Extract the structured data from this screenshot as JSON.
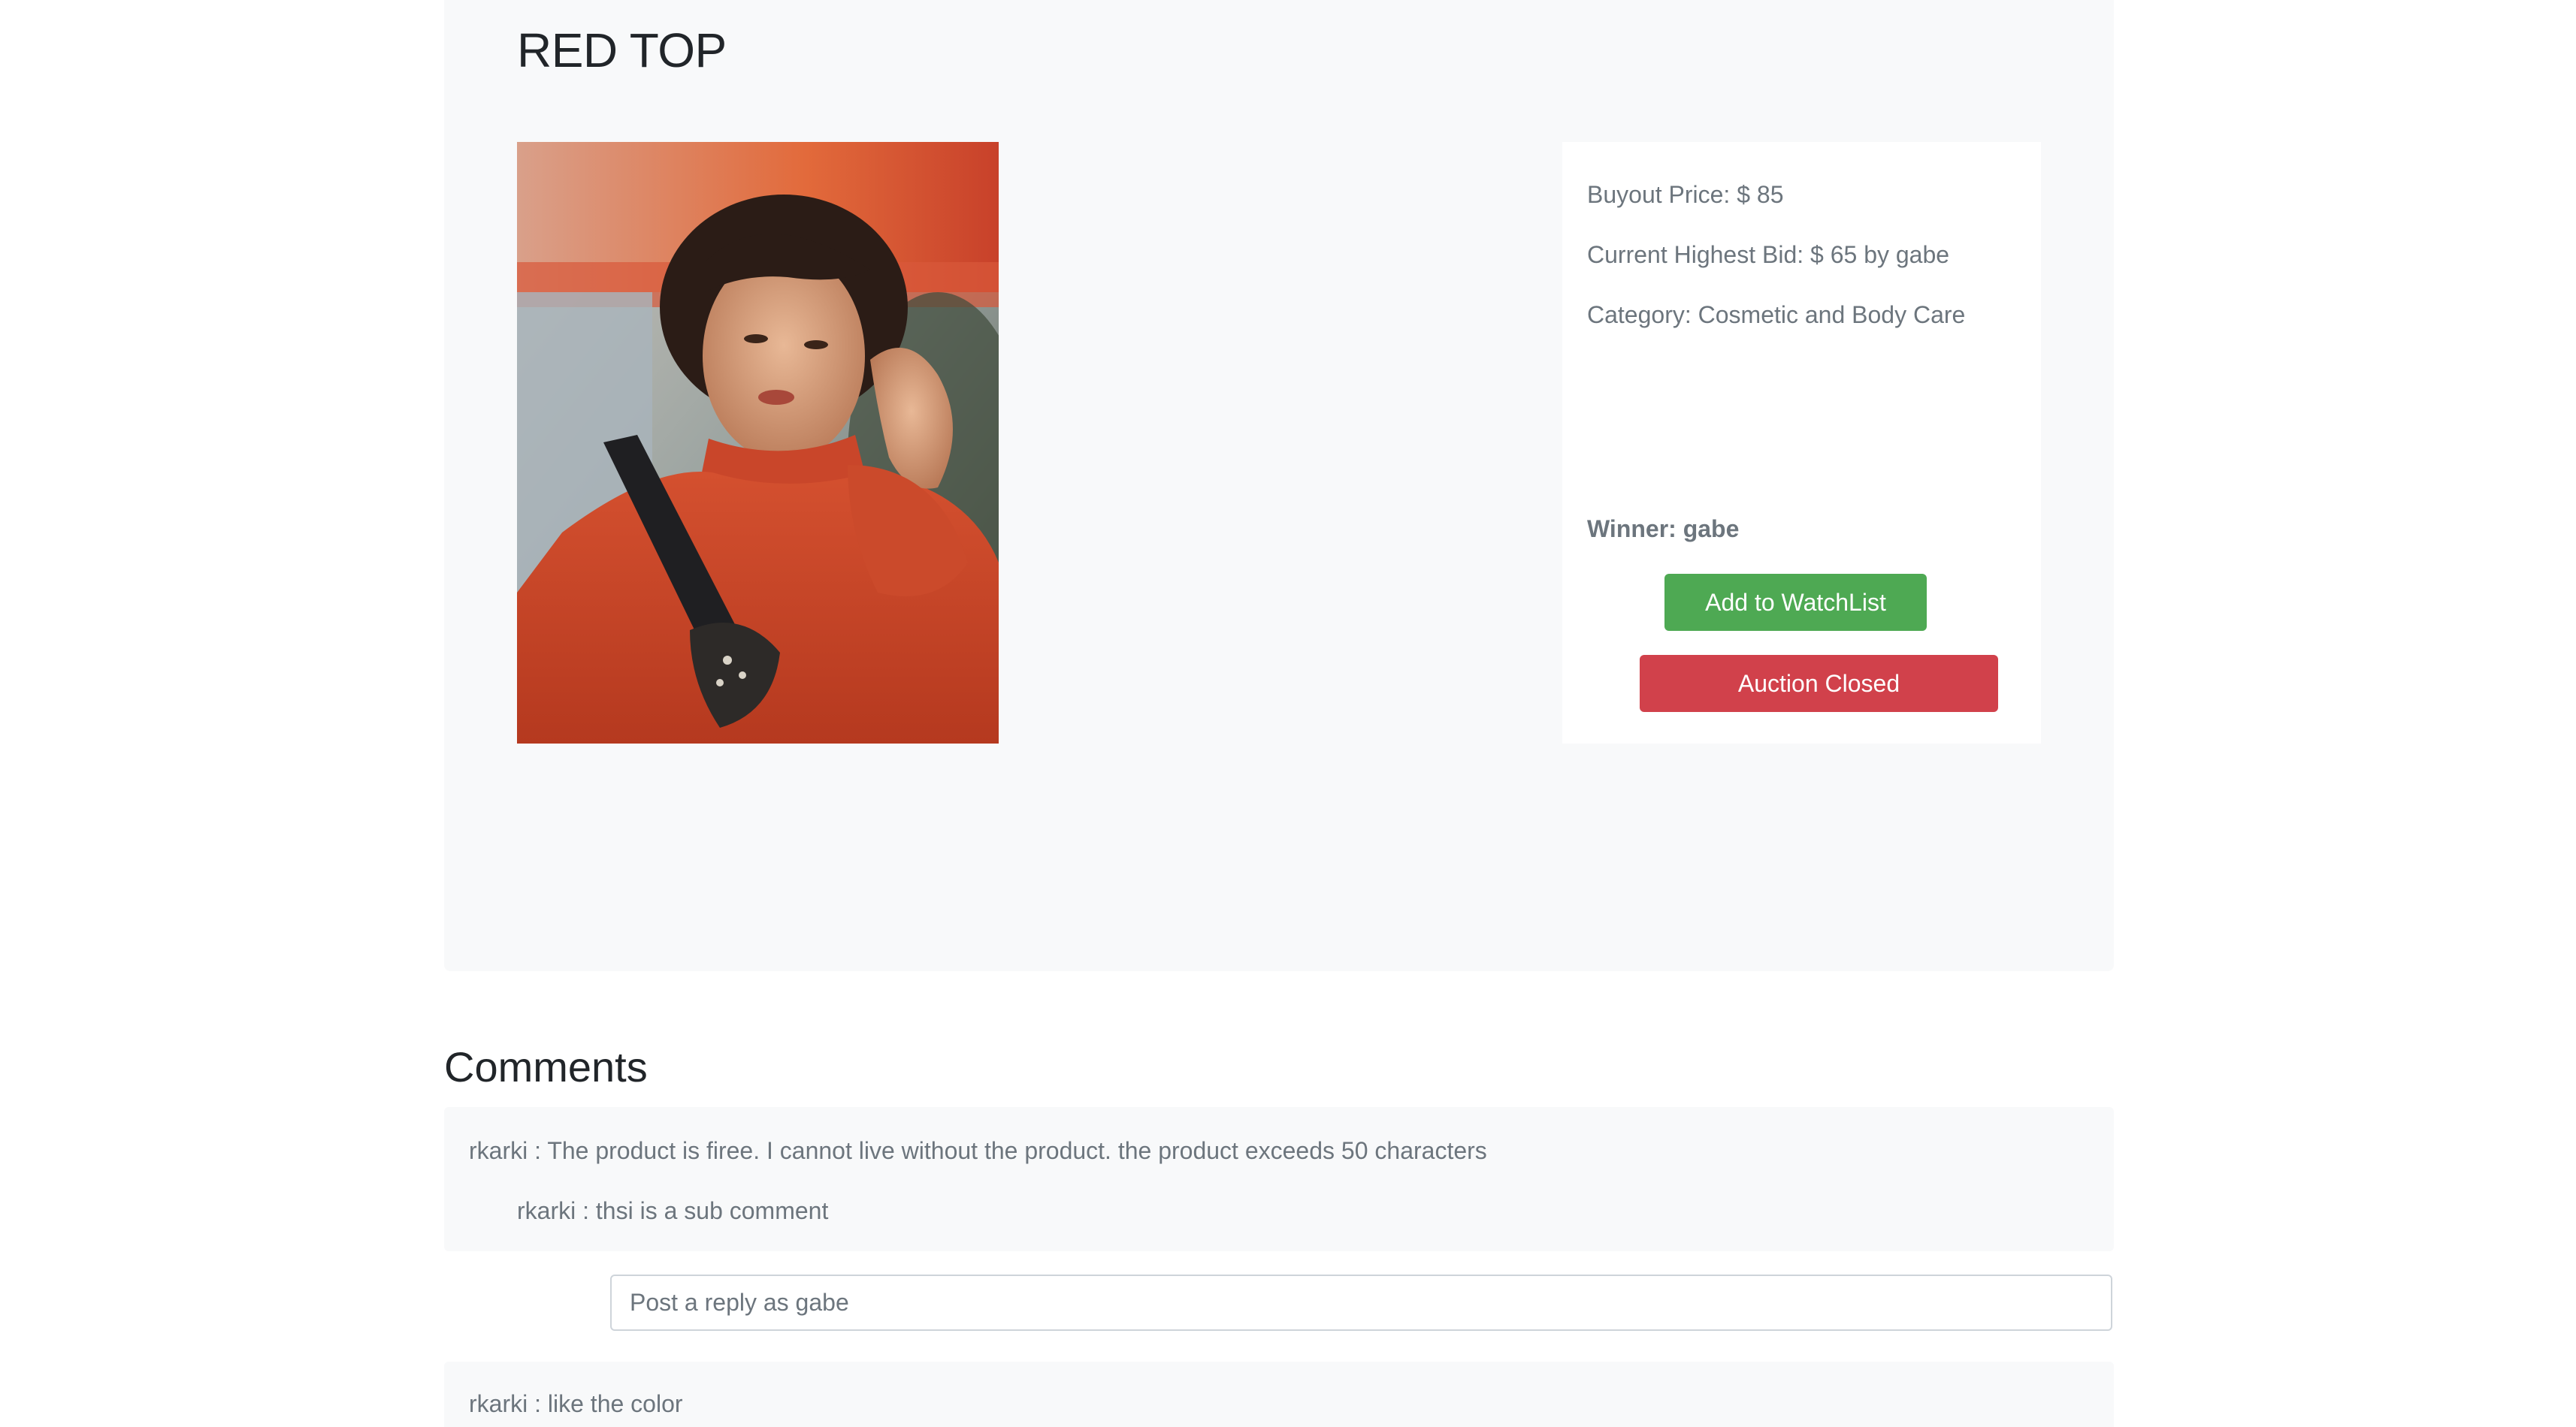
{
  "product": {
    "title": "RED TOP",
    "image_alt": "Woman in red turtleneck sweater"
  },
  "details": {
    "buyout": "Buyout Price: $ 85",
    "highest_bid": "Current Highest Bid: $ 65 by gabe",
    "category": "Category: Cosmetic and Body Care",
    "winner": "Winner: gabe",
    "watchlist_label": "Add to WatchList",
    "closed_label": "Auction Closed"
  },
  "comments": {
    "heading": "Comments",
    "items": [
      {
        "text": "rkarki : The product is firee. I cannot live without the product. the product exceeds 50 characters",
        "replies": [
          "rkarki : thsi is a sub comment"
        ]
      },
      {
        "text": "rkarki : like the color",
        "replies": []
      }
    ],
    "reply_placeholder": "Post a reply as gabe"
  },
  "colors": {
    "panel_bg": "#f8f9fa",
    "success": "#4ea953",
    "danger": "#d1414b",
    "muted_text": "#6c757d"
  }
}
